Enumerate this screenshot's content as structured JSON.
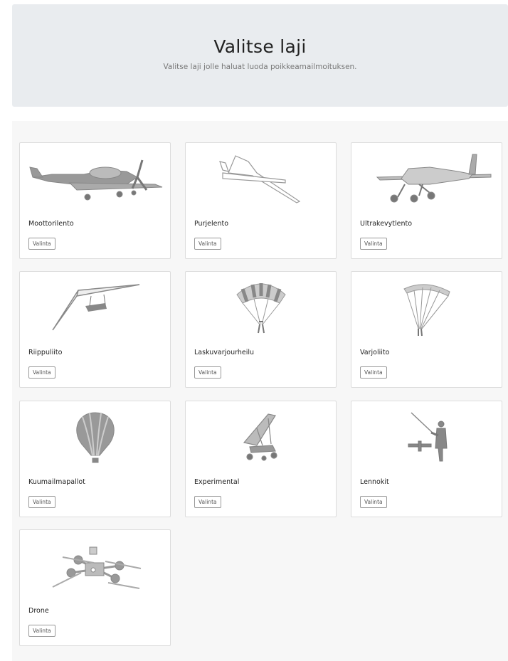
{
  "header": {
    "title": "Valitse laji",
    "subtitle": "Valitse laji jolle haluat luoda poikkeamailmoituksen."
  },
  "sports": [
    {
      "name": "Moottorilento",
      "button": "Valinta",
      "icon": "motor-plane-icon"
    },
    {
      "name": "Purjelento",
      "button": "Valinta",
      "icon": "glider-icon"
    },
    {
      "name": "Ultrakevytlento",
      "button": "Valinta",
      "icon": "ultralight-plane-icon"
    },
    {
      "name": "Riippuliito",
      "button": "Valinta",
      "icon": "hang-glider-icon"
    },
    {
      "name": "Laskuvarjourheilu",
      "button": "Valinta",
      "icon": "parachute-icon"
    },
    {
      "name": "Varjoliito",
      "button": "Valinta",
      "icon": "paraglider-icon"
    },
    {
      "name": "Kuumailmapallot",
      "button": "Valinta",
      "icon": "hot-air-balloon-icon"
    },
    {
      "name": "Experimental",
      "button": "Valinta",
      "icon": "experimental-trike-icon"
    },
    {
      "name": "Lennokit",
      "button": "Valinta",
      "icon": "rc-model-icon"
    },
    {
      "name": "Drone",
      "button": "Valinta",
      "icon": "drone-icon"
    }
  ]
}
